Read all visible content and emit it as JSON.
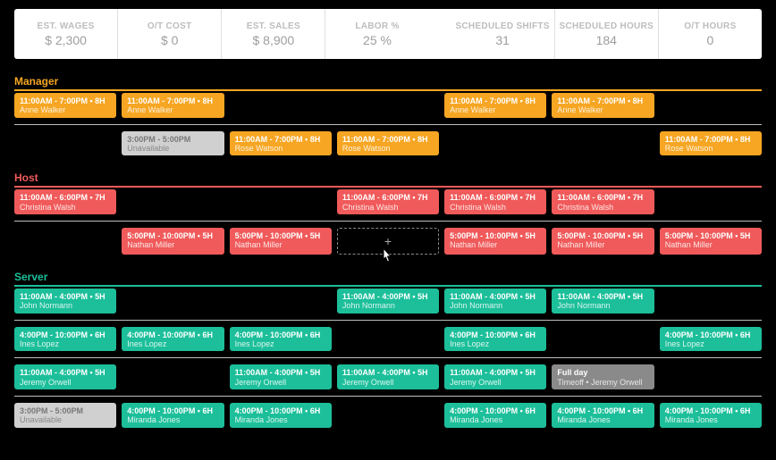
{
  "stats": [
    {
      "label": "EST. WAGES",
      "value": "$ 2,300"
    },
    {
      "label": "O/T COST",
      "value": "$ 0"
    },
    {
      "label": "EST. SALES",
      "value": "$ 8,900"
    },
    {
      "label": "LABOR %",
      "value": "25 %"
    },
    {
      "label": "SCHEDULED SHIFTS",
      "value": "31"
    },
    {
      "label": "SCHEDULED HOURS",
      "value": "184"
    },
    {
      "label": "O/T HOURS",
      "value": "0"
    }
  ],
  "roles": {
    "manager": {
      "title": "Manager"
    },
    "host": {
      "title": "Host"
    },
    "server": {
      "title": "Server"
    }
  },
  "add_symbol": "+",
  "shifts": {
    "anne1": {
      "time": "11:00AM - 7:00PM • 8H",
      "emp": "Anne Walker"
    },
    "anne2": {
      "time": "11:00AM - 7:00PM • 8H",
      "emp": "Anne Walker"
    },
    "anne3": {
      "time": "11:00AM - 7:00PM • 8H",
      "emp": "Anne Walker"
    },
    "anne4": {
      "time": "11:00AM - 7:00PM • 8H",
      "emp": "Anne Walker"
    },
    "unavail1": {
      "time": "3:00PM - 5:00PM",
      "emp": "Unavailable"
    },
    "rose1": {
      "time": "11:00AM - 7:00PM • 8H",
      "emp": "Rose Watson"
    },
    "rose2": {
      "time": "11:00AM - 7:00PM • 8H",
      "emp": "Rose Watson"
    },
    "rose3": {
      "time": "11:00AM - 7:00PM • 8H",
      "emp": "Rose Watson"
    },
    "christina1": {
      "time": "11:00AM - 6:00PM • 7H",
      "emp": "Christina Walsh"
    },
    "christina2": {
      "time": "11:00AM - 6:00PM • 7H",
      "emp": "Christina Walsh"
    },
    "christina3": {
      "time": "11:00AM - 6:00PM • 7H",
      "emp": "Christina Walsh"
    },
    "christina4": {
      "time": "11:00AM - 6:00PM • 7H",
      "emp": "Christina Walsh"
    },
    "nathan1": {
      "time": "5:00PM - 10:00PM • 5H",
      "emp": "Nathan Miller"
    },
    "nathan2": {
      "time": "5:00PM - 10:00PM • 5H",
      "emp": "Nathan Miller"
    },
    "nathan3": {
      "time": "5:00PM - 10:00PM • 5H",
      "emp": "Nathan Miller"
    },
    "nathan4": {
      "time": "5:00PM - 10:00PM • 5H",
      "emp": "Nathan Miller"
    },
    "nathan5": {
      "time": "5:00PM - 10:00PM • 5H",
      "emp": "Nathan Miller"
    },
    "john1": {
      "time": "11:00AM - 4:00PM • 5H",
      "emp": "John Normann"
    },
    "john2": {
      "time": "11:00AM - 4:00PM • 5H",
      "emp": "John Normann"
    },
    "john3": {
      "time": "11:00AM - 4:00PM • 5H",
      "emp": "John Normann"
    },
    "john4": {
      "time": "11:00AM - 4:00PM • 5H",
      "emp": "John Normann"
    },
    "ines1": {
      "time": "4:00PM - 10:00PM • 6H",
      "emp": "Ines Lopez"
    },
    "ines2": {
      "time": "4:00PM - 10:00PM • 6H",
      "emp": "Ines Lopez"
    },
    "ines3": {
      "time": "4:00PM - 10:00PM • 6H",
      "emp": "Ines Lopez"
    },
    "ines4": {
      "time": "4:00PM - 10:00PM • 6H",
      "emp": "Ines Lopez"
    },
    "ines5": {
      "time": "4:00PM - 10:00PM • 6H",
      "emp": "Ines Lopez"
    },
    "jeremy1": {
      "time": "11:00AM - 4:00PM • 5H",
      "emp": "Jeremy Orwell"
    },
    "jeremy2": {
      "time": "11:00AM - 4:00PM • 5H",
      "emp": "Jeremy Orwell"
    },
    "jeremy3": {
      "time": "11:00AM - 4:00PM • 5H",
      "emp": "Jeremy Orwell"
    },
    "jeremy4": {
      "time": "11:00AM - 4:00PM • 5H",
      "emp": "Jeremy Orwell"
    },
    "timeoff": {
      "time": "Full day",
      "emp": "Timeoff • Jeremy Orwell"
    },
    "unavail2": {
      "time": "3:00PM - 5:00PM",
      "emp": "Unavailable"
    },
    "miranda1": {
      "time": "4:00PM - 10:00PM • 6H",
      "emp": "Miranda Jones"
    },
    "miranda2": {
      "time": "4:00PM - 10:00PM • 6H",
      "emp": "Miranda Jones"
    },
    "miranda3": {
      "time": "4:00PM - 10:00PM • 6H",
      "emp": "Miranda Jones"
    },
    "miranda4": {
      "time": "4:00PM - 10:00PM • 6H",
      "emp": "Miranda Jones"
    },
    "miranda5": {
      "time": "4:00PM - 10:00PM • 6H",
      "emp": "Miranda Jones"
    }
  }
}
